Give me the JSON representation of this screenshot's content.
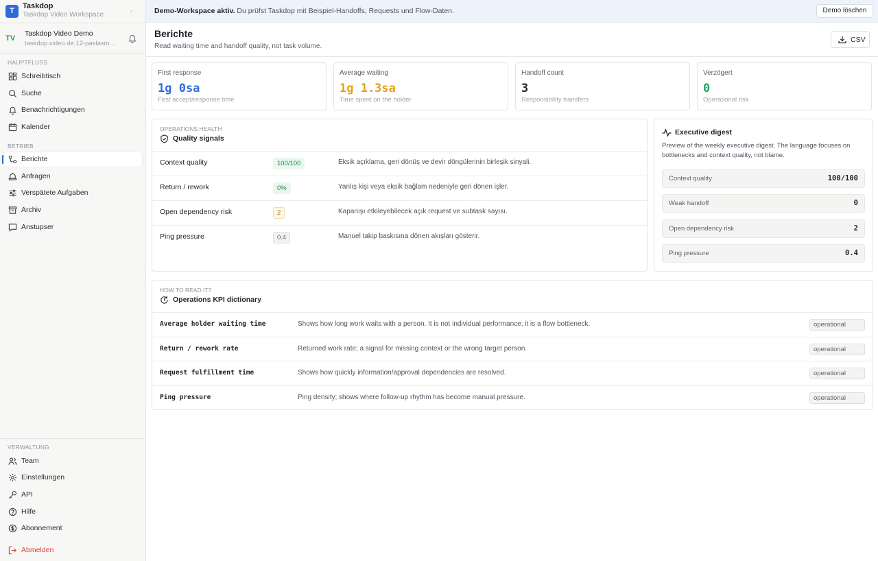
{
  "brand": {
    "title": "Taskdop",
    "subtitle": "Taskdop Video Workspace",
    "logo_letter": "T",
    "collapse_glyph": "‹"
  },
  "org": {
    "initials": "TV",
    "name": "Taskdop Video Demo",
    "url": "taskdop.video.de.12-paslasm..."
  },
  "sidebar": {
    "sections": {
      "main": "HAUPTFLUSS",
      "ops": "BETRIEB",
      "admin": "VERWALTUNG"
    },
    "main_items": [
      {
        "label": "Schreibtisch",
        "icon": "dashboard-icon"
      },
      {
        "label": "Suche",
        "icon": "search-icon"
      },
      {
        "label": "Benachrichtigungen",
        "icon": "bell-icon"
      },
      {
        "label": "Kalender",
        "icon": "calendar-icon"
      }
    ],
    "ops_items": [
      {
        "label": "Berichte",
        "icon": "reports-icon",
        "active": true
      },
      {
        "label": "Anfragen",
        "icon": "requests-icon"
      },
      {
        "label": "Verspätete Aufgaben",
        "icon": "sliders-icon"
      },
      {
        "label": "Archiv",
        "icon": "archive-icon"
      },
      {
        "label": "Anstupser",
        "icon": "message-icon"
      }
    ],
    "admin_items": [
      {
        "label": "Team",
        "icon": "team-icon"
      },
      {
        "label": "Einstellungen",
        "icon": "settings-icon"
      },
      {
        "label": "API",
        "icon": "key-icon"
      },
      {
        "label": "Hilfe",
        "icon": "help-icon"
      },
      {
        "label": "Abonnement",
        "icon": "dollar-icon"
      }
    ],
    "logout": {
      "label": "Abmelden",
      "icon": "logout-icon",
      "color": "#d6453d"
    }
  },
  "banner": {
    "bold": "Demo-Workspace aktiv.",
    "text": "Du prüfst Taskdop mit Beispiel-Handoffs, Requests und Flow-Daten.",
    "button": "Demo löschen"
  },
  "header": {
    "title": "Berichte",
    "subtitle": "Read waiting time and handoff quality, not task volume.",
    "csv_label": "CSV"
  },
  "kpis": [
    {
      "label": "First response",
      "value": "1g 0sa",
      "sub": "First accept/response time",
      "color": "#2f6bd8"
    },
    {
      "label": "Average waiting",
      "value": "1g 1.3sa",
      "sub": "Time spent on the holder",
      "color": "#e0a21c"
    },
    {
      "label": "Handoff count",
      "value": "3",
      "sub": "Responsibility transfers",
      "color": "#1f2328"
    },
    {
      "label": "Verzögert",
      "value": "0",
      "sub": "Operational risk",
      "color": "#25a266"
    }
  ],
  "quality": {
    "eyebrow": "OPERATIONS HEALTH",
    "title": "Quality signals",
    "rows": [
      {
        "name": "Context quality",
        "badge": "100/100",
        "style": "green",
        "desc": "Eksik açıklama, geri dönüş ve devir döngülerinin birleşik sinyali."
      },
      {
        "name": "Return / rework",
        "badge": "0%",
        "style": "green",
        "desc": "Yanlış kişi veya eksik bağlam nedeniyle geri dönen işler."
      },
      {
        "name": "Open dependency risk",
        "badge": "2",
        "style": "amber",
        "desc": "Kapanışı etkileyebilecek açık request ve subtask sayısı."
      },
      {
        "name": "Ping pressure",
        "badge": "0.4",
        "style": "gray",
        "desc": "Manuel takip baskısına dönen akışları gösterir."
      }
    ]
  },
  "digest": {
    "title": "Executive digest",
    "text": "Preview of the weekly executive digest. The language focuses on bottlenecks and context quality, not blame.",
    "rows": [
      {
        "label": "Context quality",
        "value": "100/100"
      },
      {
        "label": "Weak handoff",
        "value": "0"
      },
      {
        "label": "Open dependency risk",
        "value": "2"
      },
      {
        "label": "Ping pressure",
        "value": "0.4"
      }
    ]
  },
  "dictionary": {
    "eyebrow": "HOW TO READ IT?",
    "title": "Operations KPI dictionary",
    "rows": [
      {
        "term": "Average holder waiting time",
        "desc": "Shows how long work waits with a person. It is not individual performance; it is a flow bottleneck.",
        "tag": "operational"
      },
      {
        "term": "Return / rework rate",
        "desc": "Returned work rate; a signal for missing context or the wrong target person.",
        "tag": "operational"
      },
      {
        "term": "Request fulfillment time",
        "desc": "Shows how quickly information/approval dependencies are resolved.",
        "tag": "operational"
      },
      {
        "term": "Ping pressure",
        "desc": "Ping density; shows where follow-up rhythm has become manual pressure.",
        "tag": "operational"
      }
    ]
  }
}
